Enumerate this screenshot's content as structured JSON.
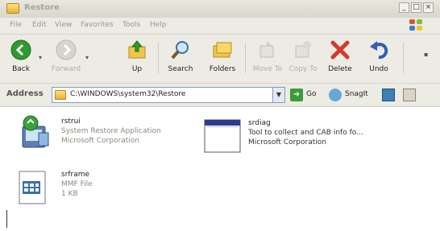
{
  "window": {
    "title": "Restore",
    "caption_buttons": [
      "_",
      "□",
      "×"
    ]
  },
  "menu": {
    "items": [
      "File",
      "Edit",
      "View",
      "Favorites",
      "Tools",
      "Help"
    ]
  },
  "toolbar": {
    "back": "Back",
    "forward": "Forward",
    "up": "Up",
    "search": "Search",
    "folders": "Folders",
    "move_to": "Move To",
    "copy_to": "Copy To",
    "delete": "Delete",
    "undo": "Undo"
  },
  "address": {
    "label": "Address",
    "path": "C:\\WINDOWS\\system32\\Restore",
    "go": "Go",
    "snagit": "SnagIt"
  },
  "files": [
    {
      "name": "rstrui",
      "line2": "System Restore Application",
      "line3": "Microsoft Corporation",
      "icon": "system-restore-icon"
    },
    {
      "name": "srdiag",
      "line2": "Tool to collect and CAB info fo...",
      "line3": "Microsoft Corporation",
      "icon": "application-window-icon"
    },
    {
      "name": "srframe",
      "line2": "MMF File",
      "line3": "1 KB",
      "icon": "mmf-file-icon"
    }
  ],
  "colors": {
    "delete_red": "#d23a2a",
    "back_green": "#2f9a2f",
    "folder_yellow": "#e5b33a",
    "address_border": "#7f9db9"
  }
}
